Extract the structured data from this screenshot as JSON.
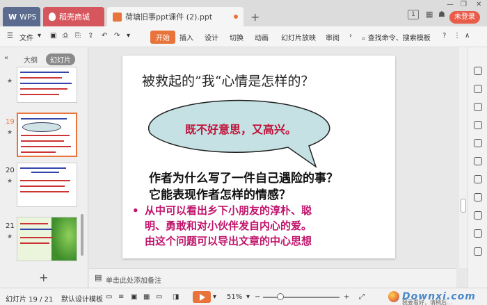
{
  "titlebar": {
    "tabs": [
      {
        "label": "WPS"
      },
      {
        "label": "稻壳商城"
      },
      {
        "label": "荷塘旧事ppt课件 (2).ppt"
      }
    ],
    "badge": "1",
    "login_label": "未登录"
  },
  "menubar": {
    "file_label": "文件",
    "items": [
      "开始",
      "插入",
      "设计",
      "切换",
      "动画",
      "幻灯片放映",
      "审阅"
    ],
    "search_label": "查找命令、搜索模板"
  },
  "left_panel": {
    "tabs": [
      "大纲",
      "幻灯片"
    ],
    "slide_numbers": [
      "19",
      "20",
      "21"
    ]
  },
  "slide": {
    "title": "被救起的”我“心情是怎样的？",
    "bubble_text": "既不好意思，又高兴。",
    "question_line1": "作者为什么写了一件自己遇险的事？",
    "question_line2": "它能表现作者怎样的情感？",
    "answer_lines": [
      "从中可以看出乡下小朋友的淳朴、聪",
      "明、勇敢和对小伙伴发自内心的爱。",
      "由这个问题可以导出文章的中心思想"
    ],
    "bullet": "•"
  },
  "notes": {
    "placeholder": "单击此处添加备注"
  },
  "statusbar": {
    "slide_counter": "幻灯片 19 / 21",
    "template": "默认设计模板",
    "zoom": "51%",
    "zoom_level": 0.51,
    "watermark": "Downxi.com",
    "watermark_sub": "我要看好，请稍后..."
  }
}
